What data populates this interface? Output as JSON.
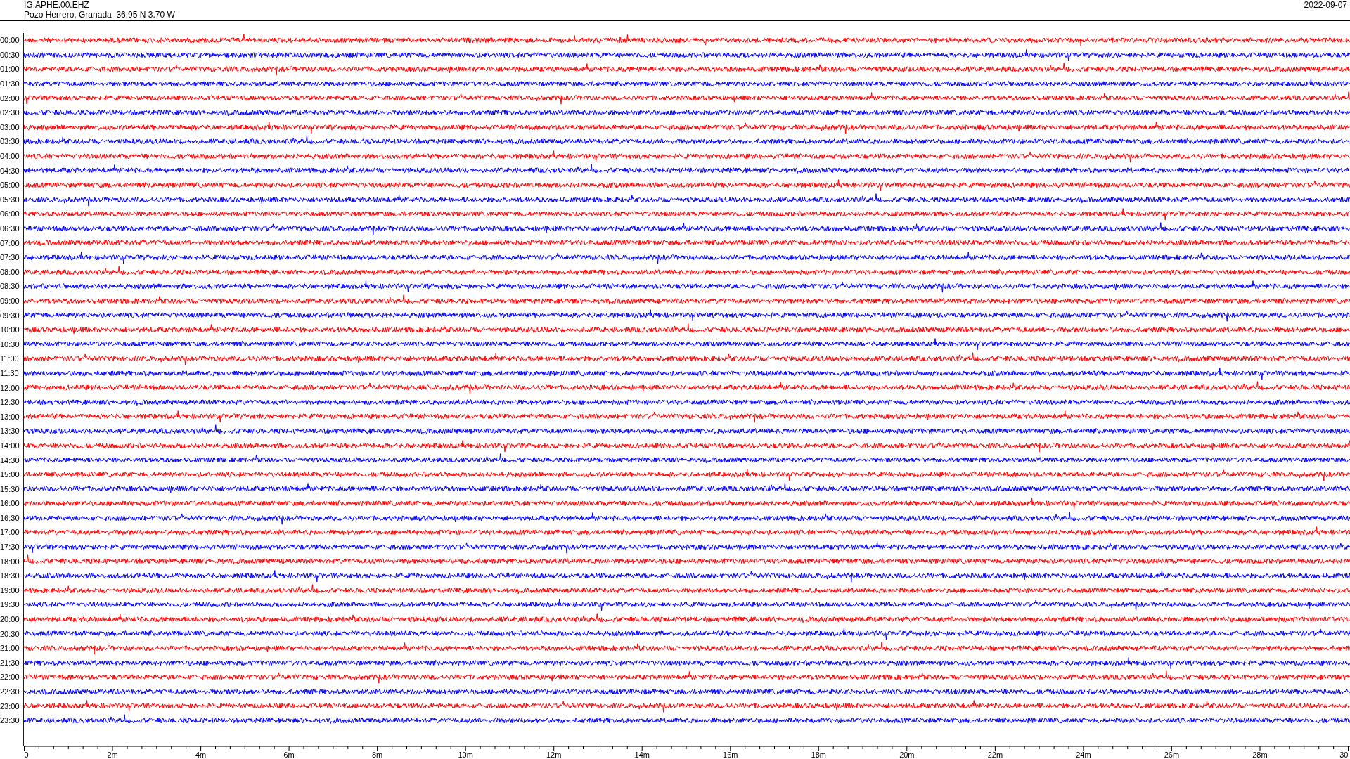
{
  "header": {
    "station": "IG.APHE.00.EHZ",
    "location": "Pozo Herrero, Granada  36.95 N 3.70 W",
    "date": "2022-09-07"
  },
  "rows": [
    {
      "time": "00:00",
      "color": "#ff0000"
    },
    {
      "time": "00:30",
      "color": "#0000ff"
    },
    {
      "time": "01:00",
      "color": "#ff0000"
    },
    {
      "time": "01:30",
      "color": "#0000ff"
    },
    {
      "time": "02:00",
      "color": "#ff0000"
    },
    {
      "time": "02:30",
      "color": "#0000ff"
    },
    {
      "time": "03:00",
      "color": "#ff0000"
    },
    {
      "time": "03:30",
      "color": "#0000ff"
    },
    {
      "time": "04:00",
      "color": "#ff0000"
    },
    {
      "time": "04:30",
      "color": "#0000ff"
    },
    {
      "time": "05:00",
      "color": "#ff0000"
    },
    {
      "time": "05:30",
      "color": "#0000ff"
    },
    {
      "time": "06:00",
      "color": "#ff0000"
    },
    {
      "time": "06:30",
      "color": "#0000ff"
    },
    {
      "time": "07:00",
      "color": "#ff0000"
    },
    {
      "time": "07:30",
      "color": "#0000ff"
    },
    {
      "time": "08:00",
      "color": "#ff0000"
    },
    {
      "time": "08:30",
      "color": "#0000ff"
    },
    {
      "time": "09:00",
      "color": "#ff0000"
    },
    {
      "time": "09:30",
      "color": "#0000ff"
    },
    {
      "time": "10:00",
      "color": "#ff0000"
    },
    {
      "time": "10:30",
      "color": "#0000ff"
    },
    {
      "time": "11:00",
      "color": "#ff0000"
    },
    {
      "time": "11:30",
      "color": "#0000ff"
    },
    {
      "time": "12:00",
      "color": "#ff0000"
    },
    {
      "time": "12:30",
      "color": "#0000ff"
    },
    {
      "time": "13:00",
      "color": "#ff0000"
    },
    {
      "time": "13:30",
      "color": "#0000ff"
    },
    {
      "time": "14:00",
      "color": "#ff0000"
    },
    {
      "time": "14:30",
      "color": "#0000ff"
    },
    {
      "time": "15:00",
      "color": "#ff0000"
    },
    {
      "time": "15:30",
      "color": "#0000ff"
    },
    {
      "time": "16:00",
      "color": "#ff0000"
    },
    {
      "time": "16:30",
      "color": "#0000ff"
    },
    {
      "time": "17:00",
      "color": "#ff0000"
    },
    {
      "time": "17:30",
      "color": "#0000ff"
    },
    {
      "time": "18:00",
      "color": "#ff0000"
    },
    {
      "time": "18:30",
      "color": "#0000ff"
    },
    {
      "time": "19:00",
      "color": "#ff0000"
    },
    {
      "time": "19:30",
      "color": "#0000ff"
    },
    {
      "time": "20:00",
      "color": "#ff0000"
    },
    {
      "time": "20:30",
      "color": "#0000ff"
    },
    {
      "time": "21:00",
      "color": "#ff0000"
    },
    {
      "time": "21:30",
      "color": "#0000ff"
    },
    {
      "time": "22:00",
      "color": "#ff0000"
    },
    {
      "time": "22:30",
      "color": "#0000ff"
    },
    {
      "time": "23:00",
      "color": "#ff0000"
    },
    {
      "time": "23:30",
      "color": "#0000ff"
    }
  ],
  "x_axis": {
    "ticks": [
      "0",
      "2m",
      "4m",
      "6m",
      "8m",
      "10m",
      "12m",
      "14m",
      "16m",
      "18m",
      "20m",
      "22m",
      "24m",
      "26m",
      "28m",
      "30"
    ]
  }
}
